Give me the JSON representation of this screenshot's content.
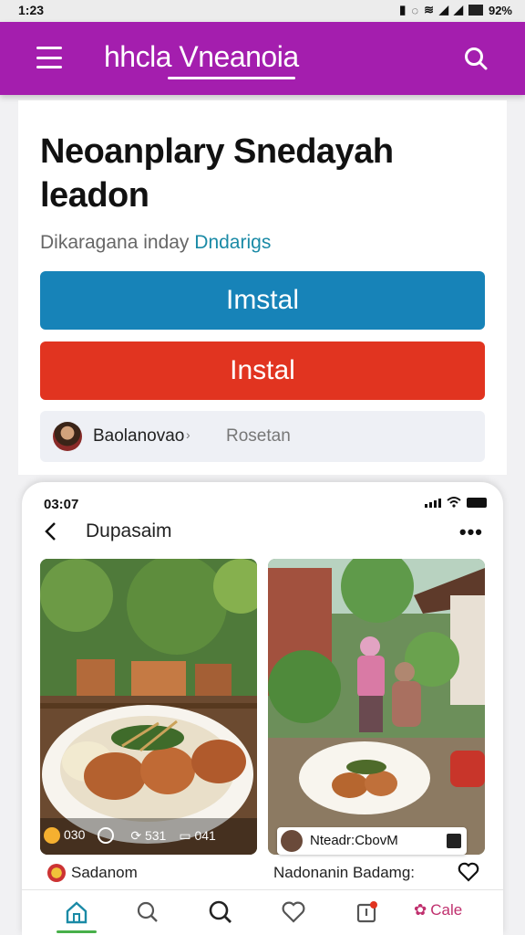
{
  "status_bar": {
    "time": "1:23",
    "right_text": "92%"
  },
  "app_bar": {
    "title": "hhcla Vneanoia"
  },
  "main": {
    "heading": "Neoanplary Snedayah leadon",
    "subtitle_prefix": "Dikaragana inday",
    "subtitle_link": "Dndarigs",
    "primary_button": "Imstal",
    "secondary_button": "Instal",
    "author": {
      "name": "Baolanovao",
      "meta": "Rosetan"
    }
  },
  "inner_screen": {
    "time": "03:07",
    "title": "Dupasaim",
    "photo_left": {
      "stats": [
        {
          "icon": "coin-icon",
          "value": "030"
        },
        {
          "icon": "clock-icon",
          "value": ""
        },
        {
          "icon": "share-icon",
          "value": "531"
        },
        {
          "icon": "cart-icon",
          "value": "041"
        }
      ],
      "caption": "Sadanom"
    },
    "photo_right": {
      "badge": "Nteadr:CbovM",
      "caption": "Nadonanin Badamg:"
    },
    "tabbar": {
      "last_label": "Cale"
    }
  },
  "colors": {
    "app_bar": "#a41eae",
    "button_blue": "#1783b8",
    "button_red": "#e13420",
    "link": "#1a8aa6"
  }
}
